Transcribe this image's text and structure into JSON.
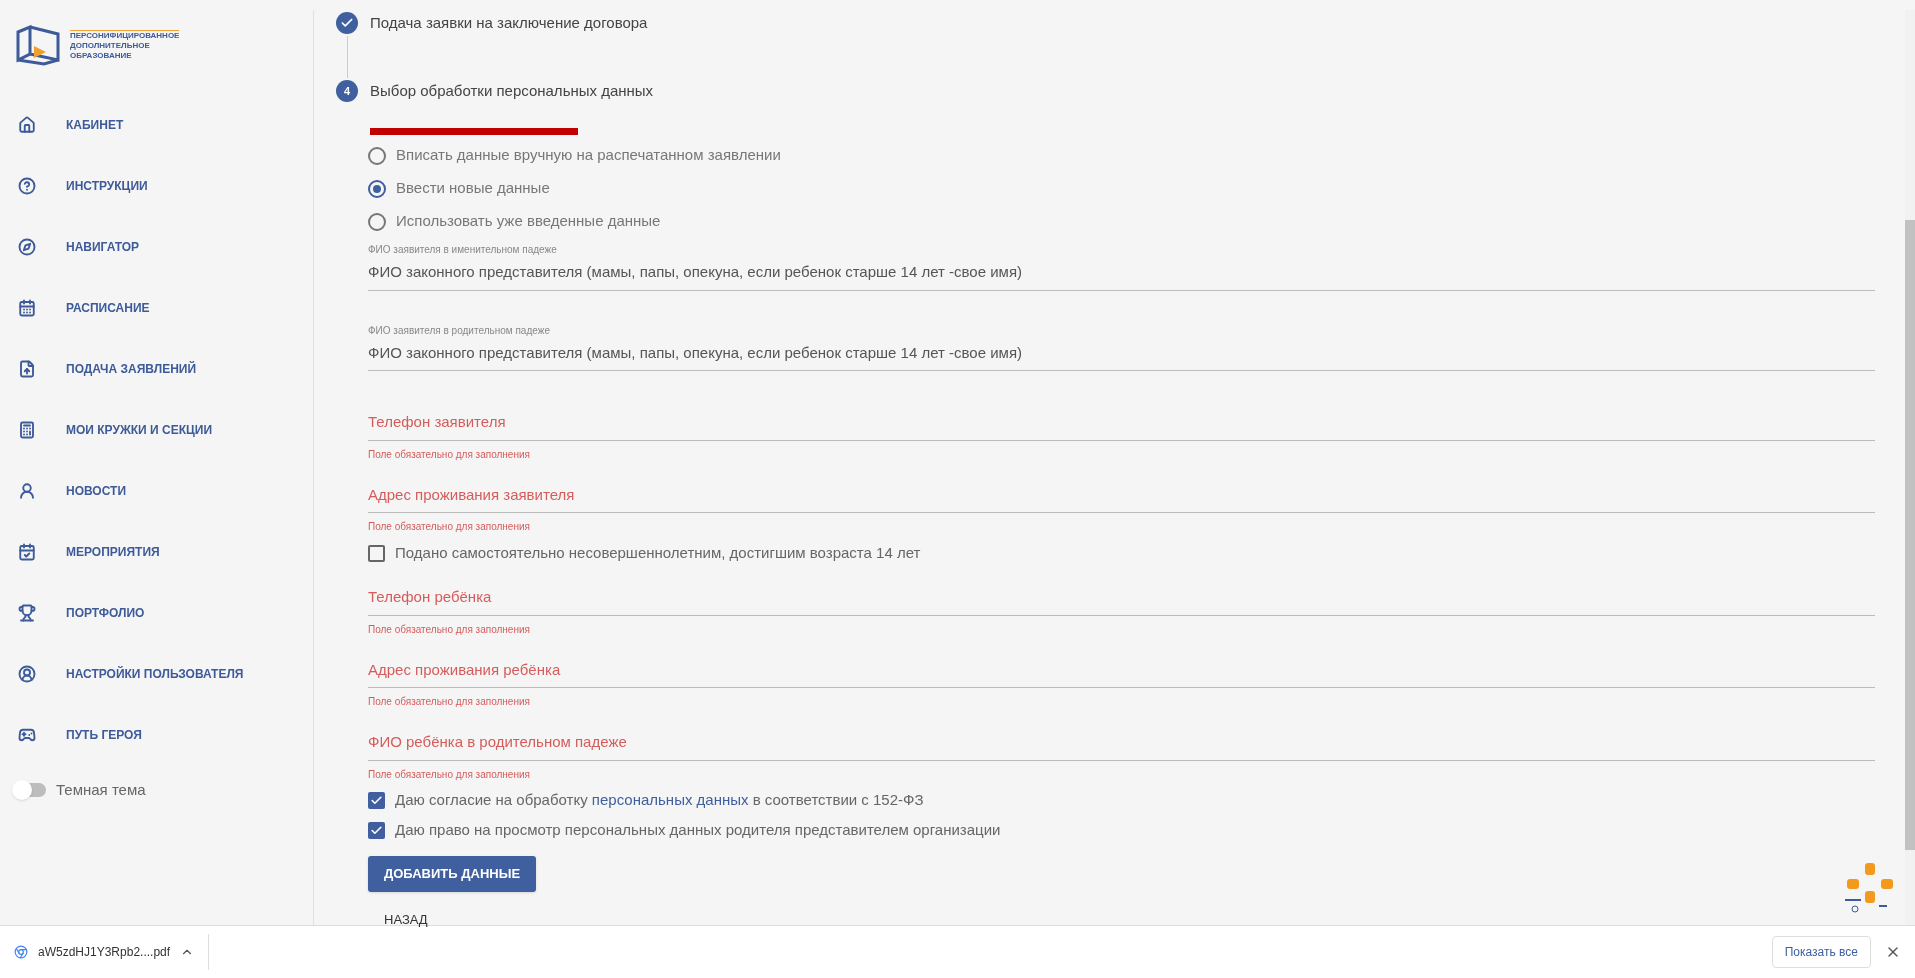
{
  "logo": {
    "lines": [
      "ПЕРСОНИФИЦИРОВАННОЕ",
      "ДОПОЛНИТЕЛЬНОЕ",
      "ОБРАЗОВАНИЕ"
    ]
  },
  "sidebar": {
    "items": [
      {
        "label": "КАБИНЕТ"
      },
      {
        "label": "ИНСТРУКЦИИ"
      },
      {
        "label": "НАВИГАТОР"
      },
      {
        "label": "РАСПИСАНИЕ"
      },
      {
        "label": "ПОДАЧА ЗАЯВЛЕНИЙ"
      },
      {
        "label": "МОИ КРУЖКИ И СЕКЦИИ"
      },
      {
        "label": "НОВОСТИ"
      },
      {
        "label": "МЕРОПРИЯТИЯ"
      },
      {
        "label": "ПОРТФОЛИО"
      },
      {
        "label": "НАСТРОЙКИ ПОЛЬЗОВАТЕЛЯ"
      },
      {
        "label": "ПУТЬ ГЕРОЯ"
      }
    ],
    "theme_toggle": {
      "label": "Темная тема",
      "on": false
    }
  },
  "steps": [
    {
      "kind": "done",
      "title": "Подача заявки на заключение договора"
    },
    {
      "kind": "number",
      "number": "4",
      "title": "Выбор обработки персональных данных"
    }
  ],
  "radios": [
    {
      "label": "Вписать данные вручную на распечатанном заявлении",
      "selected": false
    },
    {
      "label": "Ввести новые данные",
      "selected": true
    },
    {
      "label": "Использовать уже введенные данные",
      "selected": false
    }
  ],
  "form": [
    {
      "kind": "filled",
      "label": "ФИО заявителя в именительном падеже",
      "value": "ФИО законного представителя (мамы, папы, опекуна, если ребенок старше 14 лет -свое имя)"
    },
    {
      "kind": "filled",
      "label": "ФИО заявителя в родительном падеже",
      "value": "ФИО законного представителя (мамы, папы, опекуна, если ребенок старше 14 лет -свое имя)"
    },
    {
      "kind": "required",
      "label": "Телефон заявителя",
      "error": "Поле обязательно для заполнения"
    },
    {
      "kind": "required",
      "label": "Адрес проживания заявителя",
      "error": "Поле обязательно для заполнения"
    },
    {
      "kind": "checkbox",
      "label": "Подано самостоятельно несовершеннолетним, достигшим возраста 14 лет",
      "checked": false
    },
    {
      "kind": "required",
      "label": "Телефон ребёнка",
      "error": "Поле обязательно для заполнения"
    },
    {
      "kind": "required",
      "label": "Адрес проживания ребёнка",
      "error": "Поле обязательно для заполнения"
    },
    {
      "kind": "required",
      "label": "ФИО ребёнка в родительном падеже",
      "error": "Поле обязательно для заполнения"
    },
    {
      "kind": "checkbox",
      "label": "Даю согласие на обработку",
      "link": "персональных данных",
      "after": "в соответствии с 152-ФЗ",
      "checked": true
    },
    {
      "kind": "checkbox",
      "label": "Даю право на просмотр персональных данных родителя представителем организации",
      "checked": true
    }
  ],
  "buttons": {
    "primary": "ДОБАВИТЬ ДАННЫЕ",
    "back": "НАЗАД"
  },
  "download_bar": {
    "file": "aW5zdHJ1Y3Rpb2....pdf",
    "show_all": "Показать все"
  }
}
